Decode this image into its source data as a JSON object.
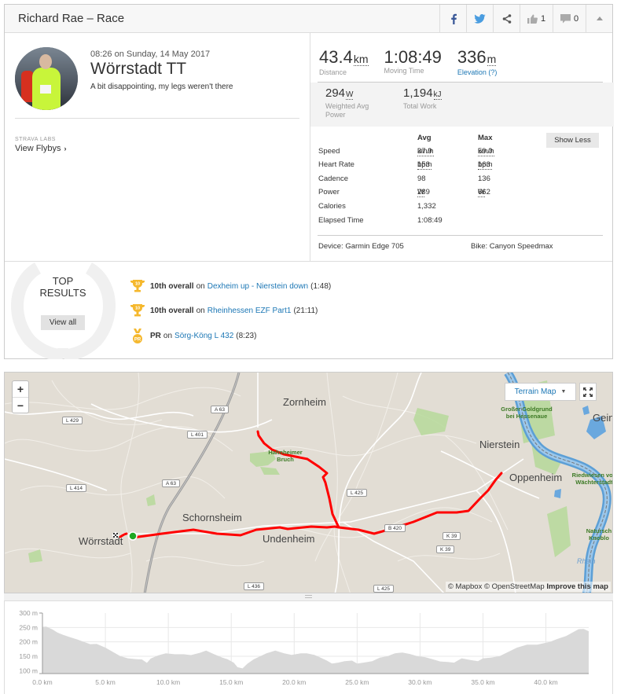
{
  "header": {
    "title": "Richard Rae – Race",
    "kudos_count": "1",
    "comment_count": "0",
    "icons": [
      "facebook-icon",
      "twitter-icon",
      "share-icon",
      "thumbs-up-icon",
      "comment-icon",
      "collapse-caret-icon"
    ]
  },
  "activity": {
    "datetime": "08:26 on Sunday, 14 May 2017",
    "name": "Wörrstadt TT",
    "description": "A bit disappointing, my legs weren't there",
    "labs_caption": "STRAVA LABS",
    "flyby_label": "View Flybys",
    "flyby_chevron": "›"
  },
  "stats": {
    "primary": [
      {
        "value": "43.4",
        "unit": "km",
        "label": "Distance"
      },
      {
        "value": "1:08:49",
        "unit": "",
        "label": "Moving Time"
      },
      {
        "value": "336",
        "unit": "m",
        "label": "Elevation (?)"
      }
    ],
    "secondary": [
      {
        "value": "294",
        "unit": "W",
        "label": "Weighted Avg Power"
      },
      {
        "value": "1,194",
        "unit": "kJ",
        "label": "Total Work"
      }
    ],
    "table_headers": {
      "avg": "Avg",
      "max": "Max"
    },
    "rows": [
      {
        "label": "Speed",
        "avg": "37.9",
        "avg_unit": "km/h",
        "max": "59.0",
        "max_unit": "km/h"
      },
      {
        "label": "Heart Rate",
        "avg": "153",
        "avg_unit": "bpm",
        "max": "163",
        "max_unit": "bpm"
      },
      {
        "label": "Cadence",
        "avg": "98",
        "avg_unit": "",
        "max": "136",
        "max_unit": ""
      },
      {
        "label": "Power",
        "avg": "289",
        "avg_unit": "W",
        "max": "662",
        "max_unit": "W"
      },
      {
        "label": "Calories",
        "avg": "1,332",
        "avg_unit": "",
        "max": "",
        "max_unit": ""
      },
      {
        "label": "Elapsed Time",
        "avg": "1:08:49",
        "avg_unit": "",
        "max": "",
        "max_unit": ""
      }
    ],
    "show_less_label": "Show Less",
    "device": "Device: Garmin Edge 705",
    "bike": "Bike: Canyon Speedmax"
  },
  "top_results": {
    "title_line1": "TOP",
    "title_line2": "RESULTS",
    "view_all_label": "View all",
    "items": [
      {
        "icon": "trophy-10-icon",
        "badge": "10",
        "rank": "10th overall",
        "on": "on",
        "segment": "Dexheim up - Nierstein down",
        "time": "(1:48)"
      },
      {
        "icon": "trophy-10-icon",
        "badge": "10",
        "rank": "10th overall",
        "on": "on",
        "segment": "Rheinhessen EZF Part1",
        "time": "(21:11)"
      },
      {
        "icon": "pr-medal-icon",
        "badge": "PR",
        "rank": "PR",
        "on": "on",
        "segment": "Sörg-Köng L 432",
        "time": "(8:23)"
      }
    ],
    "accent_color": "#f5b82e"
  },
  "map": {
    "zoom_in": "+",
    "zoom_out": "−",
    "map_type": "Terrain Map",
    "attribution_text": "© Mapbox © OpenStreetMap",
    "improve_link": "Improve this map",
    "route_color": "#ff0000",
    "places": [
      "Zornheim",
      "Nierstein",
      "Oppenheim",
      "Schornsheim",
      "Undenheim",
      "Wörrstadt",
      "Gein"
    ],
    "parks": [
      "Hahnheimer Bruch",
      "Großer Goldgrund bei Hessenaue",
      "Riedwiesen von Wächterstadt",
      "Natursch Knoblo"
    ],
    "roads": [
      "A 63",
      "L 429",
      "L 401",
      "A 63",
      "L 414",
      "L 425",
      "B 420",
      "K 39",
      "K 39",
      "L 436",
      "L 425"
    ],
    "water_label": "Rhein"
  },
  "chart_data": {
    "type": "area",
    "title": "",
    "xlabel": "",
    "ylabel": "",
    "x_unit": "km",
    "y_unit": "m",
    "xlim": [
      0,
      43.4
    ],
    "ylim": [
      90,
      300
    ],
    "x_ticks": [
      "0.0 km",
      "5.0 km",
      "10.0 km",
      "15.0 km",
      "20.0 km",
      "25.0 km",
      "30.0 km",
      "35.0 km",
      "40.0 km"
    ],
    "y_ticks": [
      "100 m",
      "150 m",
      "200 m",
      "250 m",
      "300 m"
    ],
    "grid": true,
    "fill_color": "#d9d9d9",
    "x": [
      0,
      0.3,
      0.8,
      1.2,
      1.6,
      2.2,
      2.8,
      3.3,
      3.8,
      4.3,
      5.0,
      5.6,
      6.2,
      6.8,
      7.5,
      7.9,
      8.3,
      8.6,
      9.2,
      9.8,
      10.5,
      11.2,
      11.8,
      12.5,
      13.0,
      13.6,
      14.3,
      14.7,
      15.2,
      15.5,
      15.9,
      16.3,
      16.8,
      17.3,
      17.8,
      18.5,
      19.2,
      19.8,
      20.5,
      21.0,
      21.6,
      22.1,
      22.6,
      23.0,
      23.5,
      24.0,
      24.6,
      25.0,
      25.5,
      26.2,
      26.8,
      27.4,
      28.0,
      28.6,
      29.2,
      29.8,
      30.4,
      31.0,
      31.6,
      32.2,
      32.7,
      33.3,
      34.0,
      34.6,
      35.0,
      35.6,
      36.3,
      37.0,
      37.7,
      38.5,
      39.3,
      39.8,
      40.3,
      40.9,
      41.6,
      42.1,
      42.6,
      43.0,
      43.4
    ],
    "y": [
      252,
      253,
      243,
      232,
      225,
      216,
      208,
      200,
      192,
      193,
      180,
      165,
      150,
      143,
      140,
      139,
      127,
      142,
      153,
      160,
      157,
      157,
      154,
      162,
      170,
      158,
      145,
      140,
      128,
      112,
      108,
      125,
      140,
      150,
      160,
      170,
      160,
      155,
      160,
      160,
      155,
      145,
      135,
      125,
      128,
      133,
      135,
      125,
      128,
      133,
      145,
      150,
      160,
      163,
      158,
      150,
      147,
      140,
      132,
      130,
      128,
      143,
      137,
      133,
      143,
      145,
      150,
      165,
      180,
      190,
      190,
      195,
      200,
      210,
      220,
      232,
      244,
      245,
      237
    ]
  }
}
